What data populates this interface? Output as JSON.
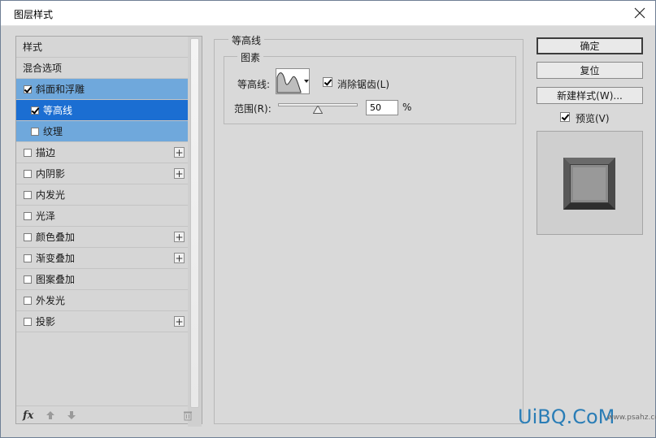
{
  "window": {
    "title": "图层样式"
  },
  "style_list": {
    "items": [
      {
        "label": "样式",
        "type": "header"
      },
      {
        "label": "混合选项",
        "type": "header"
      },
      {
        "label": "斜面和浮雕",
        "checked": true,
        "state": "selected-parent"
      },
      {
        "label": "等高线",
        "checked": true,
        "state": "selected",
        "indent": true
      },
      {
        "label": "纹理",
        "checked": false,
        "state": "selected-child",
        "indent": true
      },
      {
        "label": "描边",
        "checked": false,
        "plus": true
      },
      {
        "label": "内阴影",
        "checked": false,
        "plus": true
      },
      {
        "label": "内发光",
        "checked": false
      },
      {
        "label": "光泽",
        "checked": false
      },
      {
        "label": "颜色叠加",
        "checked": false,
        "plus": true
      },
      {
        "label": "渐变叠加",
        "checked": false,
        "plus": true
      },
      {
        "label": "图案叠加",
        "checked": false
      },
      {
        "label": "外发光",
        "checked": false
      },
      {
        "label": "投影",
        "checked": false,
        "plus": true
      }
    ],
    "fx_label": "fx",
    "plus_glyph": "+"
  },
  "panel": {
    "section_title": "等高线",
    "group_title": "图素",
    "contour_label": "等高线:",
    "antialias_label": "消除锯齿(L)",
    "range_label": "范围(R):",
    "range_value": "50",
    "range_unit": "%"
  },
  "buttons": {
    "ok": "确定",
    "reset": "复位",
    "new_style": "新建样式(W)...",
    "preview_label": "预览(V)"
  },
  "watermark": {
    "text": "UiBQ.CoM",
    "sub": "www.psahz.com"
  },
  "colors": {
    "selected": "#1b6ed2",
    "selected_light": "#6fa8dc",
    "panel_bg": "#d9d9d9"
  }
}
